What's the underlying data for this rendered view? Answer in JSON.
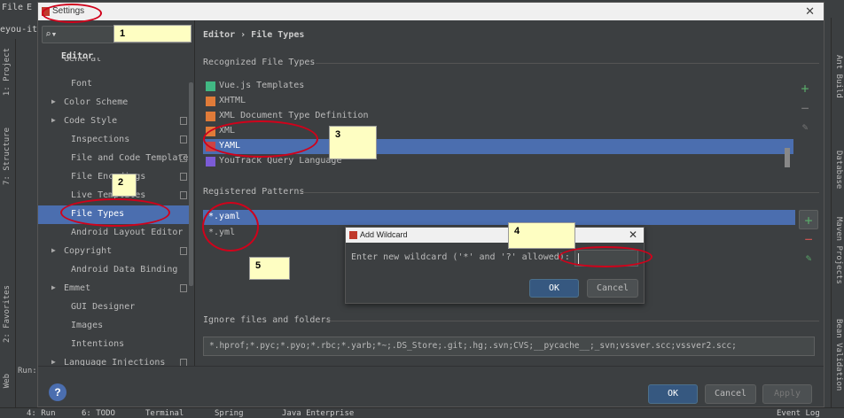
{
  "ide": {
    "menu": [
      "File",
      "E"
    ],
    "project_label": "eyou-it",
    "left_tabs": [
      "1: Project",
      "7: Structure",
      "2: Favorites",
      "Web"
    ],
    "right_tabs": [
      "Ant Build",
      "Database",
      "Maven Projects",
      "Bean Validation"
    ],
    "bottom_tabs": [
      "4: Run",
      "6: TODO",
      "Terminal",
      "Spring",
      "Java Enterprise",
      "Event Log"
    ],
    "run_label": "Run:"
  },
  "dialog": {
    "title": "Settings",
    "sidebar_header": "Editor",
    "sidebar_items": [
      {
        "label": "General",
        "arrow": "",
        "indent": 1
      },
      {
        "label": "Font",
        "arrow": "",
        "indent": 2
      },
      {
        "label": "Color Scheme",
        "arrow": "▶",
        "indent": 1
      },
      {
        "label": "Code Style",
        "arrow": "▶",
        "indent": 1
      },
      {
        "label": "Inspections",
        "arrow": "",
        "indent": 2
      },
      {
        "label": "File and Code Templates",
        "arrow": "",
        "indent": 2
      },
      {
        "label": "File Encodings",
        "arrow": "",
        "indent": 2
      },
      {
        "label": "Live Templates",
        "arrow": "",
        "indent": 2
      },
      {
        "label": "File Types",
        "arrow": "",
        "indent": 2,
        "selected": true
      },
      {
        "label": "Android Layout Editor",
        "arrow": "",
        "indent": 2
      },
      {
        "label": "Copyright",
        "arrow": "▶",
        "indent": 1
      },
      {
        "label": "Android Data Binding",
        "arrow": "",
        "indent": 2
      },
      {
        "label": "Emmet",
        "arrow": "▶",
        "indent": 1
      },
      {
        "label": "GUI Designer",
        "arrow": "",
        "indent": 2
      },
      {
        "label": "Images",
        "arrow": "",
        "indent": 2
      },
      {
        "label": "Intentions",
        "arrow": "",
        "indent": 2
      },
      {
        "label": "Language Injections",
        "arrow": "▶",
        "indent": 1
      }
    ],
    "breadcrumb": "Editor  ›  File Types",
    "recognized_label": "Recognized File Types",
    "file_types": [
      {
        "label": "Vue.js Templates",
        "icon": "vue-icon",
        "color": "#41b883"
      },
      {
        "label": "XHTML",
        "icon": "xhtml-icon",
        "color": "#e07b39"
      },
      {
        "label": "XML Document Type Definition",
        "icon": "dtd-icon",
        "color": "#e07b39"
      },
      {
        "label": "XML",
        "icon": "xml-icon",
        "color": "#e07b39"
      },
      {
        "label": "YAML",
        "icon": "yaml-icon",
        "color": "#c44",
        "selected": true
      },
      {
        "label": "YouTrack Query Language",
        "icon": "youtrack-icon",
        "color": "#7b5bd6"
      }
    ],
    "registered_label": "Registered Patterns",
    "patterns": [
      {
        "label": "*.yaml",
        "selected": true
      },
      {
        "label": "*.yml"
      }
    ],
    "ignore_label": "Ignore files and folders",
    "ignore_value": "*.hprof;*.pyc;*.pyo;*.rbc;*.yarb;*~;.DS_Store;.git;.hg;.svn;CVS;__pycache__;_svn;vssver.scc;vssver2.scc;",
    "buttons": {
      "ok": "OK",
      "cancel": "Cancel",
      "apply": "Apply",
      "help": "?"
    }
  },
  "wildcard": {
    "title": "Add Wildcard",
    "prompt": "Enter new wildcard ('*' and '?' allowed):",
    "value": "",
    "ok": "OK",
    "cancel": "Cancel"
  },
  "annotations": [
    "1",
    "2",
    "3",
    "4",
    "5"
  ],
  "colors": {
    "selection": "#4b6eaf",
    "add": "#59a869",
    "remove": "#c75450",
    "note": "#fefec2",
    "ring": "#d0021b"
  }
}
